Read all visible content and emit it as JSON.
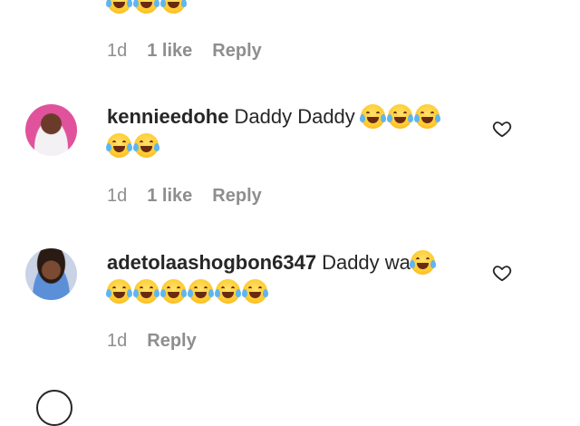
{
  "previous_comment": {
    "emoji_count": 3,
    "time": "1d",
    "likes": "1 like",
    "reply": "Reply"
  },
  "comments": [
    {
      "username": "kennieedohe",
      "text": "Daddy Daddy",
      "emoji_count": 5,
      "time": "1d",
      "likes": "1 like",
      "reply": "Reply"
    },
    {
      "username": "adetolaashogbon6347",
      "text": "Daddy wa",
      "emoji_count": 7,
      "time": "1d",
      "reply": "Reply"
    }
  ],
  "icons": {
    "like": "heart-outline-icon",
    "emoji": "face-with-tears-of-joy-emoji"
  },
  "colors": {
    "text": "#262626",
    "secondary": "#8e8e8e",
    "background": "#ffffff"
  }
}
